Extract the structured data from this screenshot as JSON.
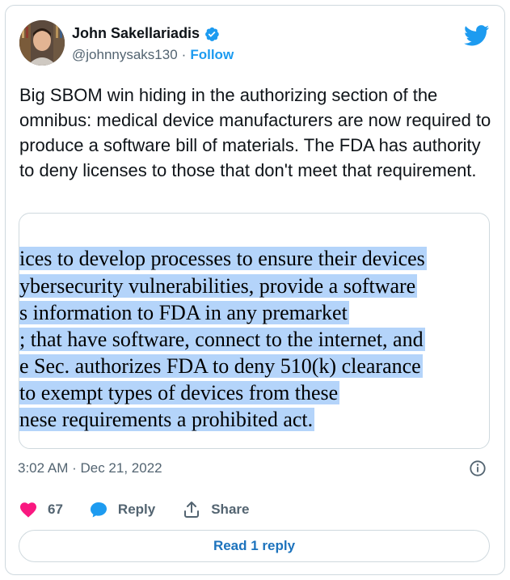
{
  "author": {
    "name": "John Sakellariadis",
    "handle": "@johnnysaks130",
    "separator": "·",
    "follow_label": "Follow",
    "verified": true
  },
  "tweet": {
    "text": "Big SBOM win hiding in the authorizing section of the omnibus: medical device manufacturers are now required to produce a software bill of materials. The FDA has authority to deny licenses to those that don't meet that requirement."
  },
  "media": {
    "lines": [
      "ices to develop processes to ensure their devices",
      "ybersecurity vulnerabilities, provide a software",
      "s information to FDA in any premarket",
      "; that have software, connect to the internet, and",
      "e Sec. authorizes FDA to deny 510(k) clearance",
      "to exempt types of devices from these",
      "nese requirements a prohibited act."
    ]
  },
  "meta": {
    "timestamp": "3:02 AM · Dec 21, 2022"
  },
  "actions": {
    "like_count": "67",
    "reply_label": "Reply",
    "share_label": "Share"
  },
  "read_reply_label": "Read 1 reply",
  "colors": {
    "accent": "#1d9bf0",
    "like": "#f91880",
    "highlight": "#b4d4fa"
  },
  "icons": [
    "twitter-bird-icon",
    "verified-badge-icon",
    "info-icon",
    "heart-icon",
    "reply-icon",
    "share-icon"
  ]
}
